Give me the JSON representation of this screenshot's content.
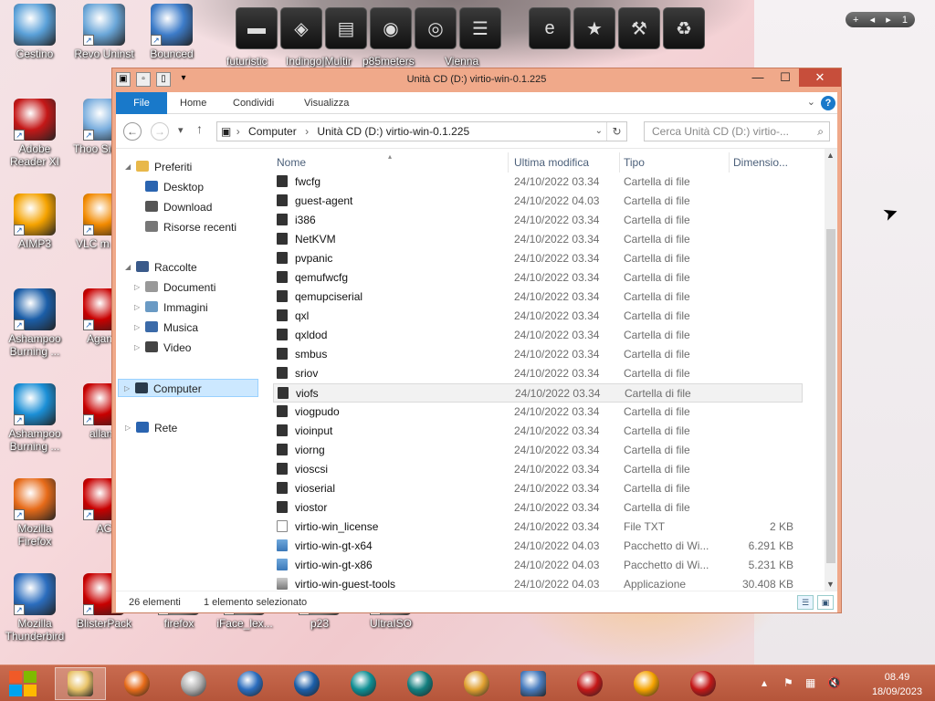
{
  "desktop": {
    "icons": [
      {
        "label": "Cestino",
        "color": "#5aa0d8"
      },
      {
        "label": "Revo Uninst",
        "color": "#6aa6d8"
      },
      {
        "label": "Bounced",
        "color": "#3d7cc9"
      },
      {
        "label": "Adobe Reader XI",
        "color": "#c41818"
      },
      {
        "label": "Thoo Sideba",
        "color": "#7aaede"
      },
      {
        "label": "AIMP3",
        "color": "#f5a300"
      },
      {
        "label": "VLC m play",
        "color": "#f28a00"
      },
      {
        "label": "Ashampoo Burning ...",
        "color": "#1b5ea8"
      },
      {
        "label": "Agame",
        "color": "#c80000"
      },
      {
        "label": "Ashampoo Burning ...",
        "color": "#1b8fd6"
      },
      {
        "label": "allanb",
        "color": "#c80000"
      },
      {
        "label": "Mozilla Firefox",
        "color": "#e76b19"
      },
      {
        "label": "AC",
        "color": "#c80000"
      },
      {
        "label": "Mozilla Thunderbird",
        "color": "#2b6dbe"
      },
      {
        "label": "BlisterPack",
        "color": "#c80000"
      },
      {
        "label": "firefox",
        "color": "#ccc"
      },
      {
        "label": "iFace_lex...",
        "color": "#ccc"
      },
      {
        "label": "p23",
        "color": "#ccc"
      },
      {
        "label": "UltraISO",
        "color": "#ccc"
      }
    ],
    "dock_labels": [
      "futuristic",
      "Indingo|Multir",
      "p85meters",
      "Vienna"
    ],
    "widget": {
      "plus": "+",
      "page": "1"
    }
  },
  "window": {
    "title": "Unità CD (D:) virtio-win-0.1.225",
    "buttons": {
      "minimize": "—",
      "maximize": "☐",
      "close": "✕"
    },
    "ribbon_tabs": [
      "File",
      "Home",
      "Condividi",
      "Visualizza"
    ],
    "help": "?",
    "address": {
      "crumbs": [
        "Computer",
        "Unità CD (D:) virtio-win-0.1.225"
      ]
    },
    "search_placeholder": "Cerca Unità CD (D:) virtio-...",
    "nav": {
      "favorites": "Preferiti",
      "desktop": "Desktop",
      "download": "Download",
      "recent": "Risorse recenti",
      "libraries": "Raccolte",
      "documents": "Documenti",
      "images": "Immagini",
      "music": "Musica",
      "video": "Video",
      "computer": "Computer",
      "network": "Rete"
    },
    "columns": {
      "name": "Nome",
      "date": "Ultima modifica",
      "type": "Tipo",
      "size": "Dimensio..."
    },
    "files": [
      {
        "name": "fwcfg",
        "date": "24/10/2022 03.34",
        "type": "Cartella di file",
        "size": "",
        "kind": "folder"
      },
      {
        "name": "guest-agent",
        "date": "24/10/2022 04.03",
        "type": "Cartella di file",
        "size": "",
        "kind": "folder"
      },
      {
        "name": "i386",
        "date": "24/10/2022 03.34",
        "type": "Cartella di file",
        "size": "",
        "kind": "folder"
      },
      {
        "name": "NetKVM",
        "date": "24/10/2022 03.34",
        "type": "Cartella di file",
        "size": "",
        "kind": "folder"
      },
      {
        "name": "pvpanic",
        "date": "24/10/2022 03.34",
        "type": "Cartella di file",
        "size": "",
        "kind": "folder"
      },
      {
        "name": "qemufwcfg",
        "date": "24/10/2022 03.34",
        "type": "Cartella di file",
        "size": "",
        "kind": "folder"
      },
      {
        "name": "qemupciserial",
        "date": "24/10/2022 03.34",
        "type": "Cartella di file",
        "size": "",
        "kind": "folder"
      },
      {
        "name": "qxl",
        "date": "24/10/2022 03.34",
        "type": "Cartella di file",
        "size": "",
        "kind": "folder"
      },
      {
        "name": "qxldod",
        "date": "24/10/2022 03.34",
        "type": "Cartella di file",
        "size": "",
        "kind": "folder"
      },
      {
        "name": "smbus",
        "date": "24/10/2022 03.34",
        "type": "Cartella di file",
        "size": "",
        "kind": "folder"
      },
      {
        "name": "sriov",
        "date": "24/10/2022 03.34",
        "type": "Cartella di file",
        "size": "",
        "kind": "folder"
      },
      {
        "name": "viofs",
        "date": "24/10/2022 03.34",
        "type": "Cartella di file",
        "size": "",
        "kind": "folder",
        "selected": true
      },
      {
        "name": "viogpudo",
        "date": "24/10/2022 03.34",
        "type": "Cartella di file",
        "size": "",
        "kind": "folder"
      },
      {
        "name": "vioinput",
        "date": "24/10/2022 03.34",
        "type": "Cartella di file",
        "size": "",
        "kind": "folder"
      },
      {
        "name": "viorng",
        "date": "24/10/2022 03.34",
        "type": "Cartella di file",
        "size": "",
        "kind": "folder"
      },
      {
        "name": "vioscsi",
        "date": "24/10/2022 03.34",
        "type": "Cartella di file",
        "size": "",
        "kind": "folder"
      },
      {
        "name": "vioserial",
        "date": "24/10/2022 03.34",
        "type": "Cartella di file",
        "size": "",
        "kind": "folder"
      },
      {
        "name": "viostor",
        "date": "24/10/2022 03.34",
        "type": "Cartella di file",
        "size": "",
        "kind": "folder"
      },
      {
        "name": "virtio-win_license",
        "date": "24/10/2022 03.34",
        "type": "File TXT",
        "size": "2 KB",
        "kind": "txt"
      },
      {
        "name": "virtio-win-gt-x64",
        "date": "24/10/2022 04.03",
        "type": "Pacchetto di Wi...",
        "size": "6.291 KB",
        "kind": "pkg"
      },
      {
        "name": "virtio-win-gt-x86",
        "date": "24/10/2022 04.03",
        "type": "Pacchetto di Wi...",
        "size": "5.231 KB",
        "kind": "pkg"
      },
      {
        "name": "virtio-win-guest-tools",
        "date": "24/10/2022 04.03",
        "type": "Applicazione",
        "size": "30.408 KB",
        "kind": "app"
      }
    ],
    "status": {
      "count": "26 elementi",
      "selection": "1 elemento selezionato"
    }
  },
  "taskbar": {
    "time": "08.49",
    "date": "18/09/2023",
    "apps": [
      {
        "name": "explorer",
        "color": "#e9c46a"
      },
      {
        "name": "firefox",
        "color": "#e76b19"
      },
      {
        "name": "cd-burner",
        "color": "#b0b0b0"
      },
      {
        "name": "thunderbird",
        "color": "#2b6dbe"
      },
      {
        "name": "ashampoo-11",
        "color": "#1b5ea8"
      },
      {
        "name": "ashampoo-burn",
        "color": "#0f8f94"
      },
      {
        "name": "ashampoo-cd",
        "color": "#127f7f"
      },
      {
        "name": "network-app",
        "color": "#e0a030"
      },
      {
        "name": "windows-app",
        "color": "#4a7ec0"
      },
      {
        "name": "redhat",
        "color": "#c41818"
      },
      {
        "name": "aimp",
        "color": "#f5a300"
      },
      {
        "name": "acrobat",
        "color": "#c41818"
      }
    ]
  }
}
